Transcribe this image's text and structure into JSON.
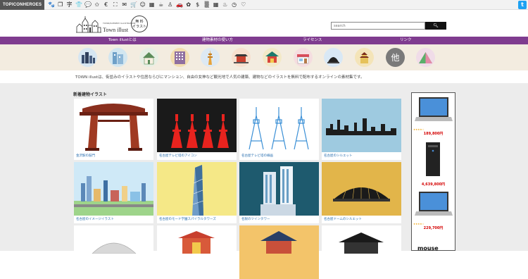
{
  "topbar": {
    "brand": "TOPICONHEROES",
    "icons": [
      "paw-icon",
      "copy-icon",
      "kanji-icon",
      "shirt-icon",
      "chat-icon",
      "star-icon",
      "yen-icon",
      "fullscreen-icon",
      "mail-icon",
      "cart-icon",
      "smiley-icon",
      "grid-icon",
      "coffee-icon",
      "person-icon",
      "car-icon",
      "flower-icon",
      "dollar-icon",
      "pattern-icon",
      "app-grid-icon",
      "bottle-icon",
      "clock-icon",
      "kanji-heart-icon"
    ],
    "icon_glyphs": [
      "🐾",
      "❐",
      "字",
      "👕",
      "💬",
      "✩",
      "€",
      "⛶",
      "✉",
      "🛒",
      "☺",
      "▦",
      "☕",
      "♙",
      "🚗",
      "✿",
      "$",
      "▒",
      "▦",
      "♨",
      "◷",
      "♡"
    ],
    "twitter_label": "t"
  },
  "header": {
    "site_name": "Town illust",
    "site_sub": "TOWN/SCENERY ILLUSTRATION",
    "free_badge": "無 料\nイラスト",
    "search_placeholder": "search"
  },
  "nav": {
    "items": [
      {
        "label": "Town illustとは"
      },
      {
        "label": "建物素材の使い方"
      },
      {
        "label": "ライセンス"
      },
      {
        "label": "リンク"
      }
    ]
  },
  "intro": "TOWN illustは、街並みのイラストや住居ならびにマンション、自由の女神など観光地で人気の建築、建物などのイラストを無料で配布するオンラインの素材集です。",
  "section_title": "新着建物イラスト",
  "cards": [
    {
      "caption": "金沢駅の鼓門"
    },
    {
      "caption": "名古屋テレビ塔のアイコン"
    },
    {
      "caption": "名古屋テレビ塔の線画"
    },
    {
      "caption": "名古屋のシルエット"
    },
    {
      "caption": "名古屋のイメージイラスト"
    },
    {
      "caption": "名古屋のモード学園スパイラルタワーズ"
    },
    {
      "caption": "名駅のツインタワー"
    },
    {
      "caption": "名古屋ドームのシルエット"
    }
  ],
  "ad": {
    "prices": [
      "189,800円",
      "4,639,800円",
      "229,700円"
    ],
    "brand": "mouse",
    "stars": "★★★★☆"
  }
}
